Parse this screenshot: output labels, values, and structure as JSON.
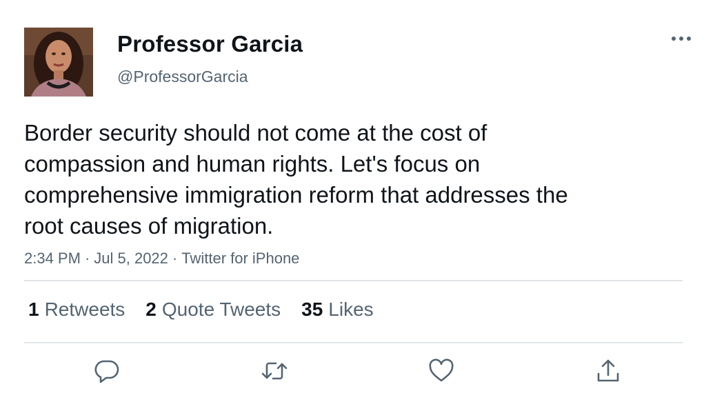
{
  "author": {
    "display_name": "Professor Garcia",
    "handle": "@ProfessorGarcia"
  },
  "tweet": {
    "text_lines": [
      "Border security should not come at the cost of",
      "compassion and human rights. Let's focus on",
      "comprehensive immigration reform that addresses the",
      "root causes of migration."
    ],
    "time": "2:34 PM",
    "date": "Jul 5, 2022",
    "source": "Twitter for iPhone",
    "separator": "·"
  },
  "stats": {
    "retweets": {
      "count": "1",
      "label": "Retweets"
    },
    "quote_tweets": {
      "count": "2",
      "label": "Quote Tweets"
    },
    "likes": {
      "count": "35",
      "label": "Likes"
    }
  },
  "icons": {
    "more": "more-horizontal-icon",
    "reply": "reply-icon",
    "retweet": "retweet-icon",
    "like": "heart-icon",
    "share": "share-icon"
  },
  "colors": {
    "text_primary": "#0f1419",
    "text_secondary": "#536471",
    "divider": "#e1e5e8",
    "icon": "#536471"
  }
}
